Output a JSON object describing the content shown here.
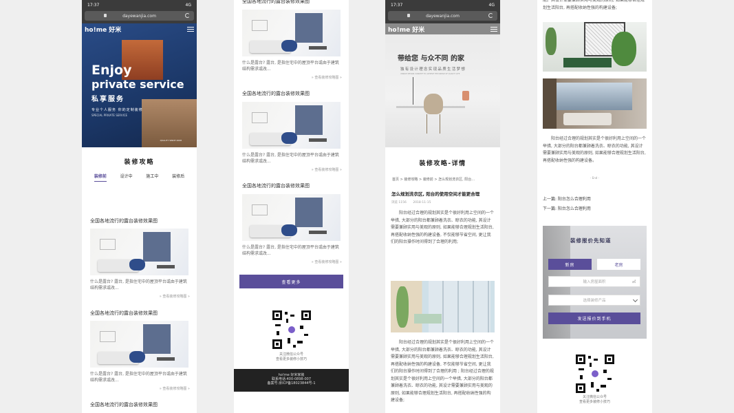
{
  "colors": {
    "accent": "#5a4e9a",
    "hero_bg": "#1f3f75",
    "phone_bar": "#3b3b3b"
  },
  "phone": {
    "time": "17:37",
    "signal": "4G",
    "url": "dayewanjia.com"
  },
  "brand": {
    "logo": "ho!me 好米"
  },
  "hero": {
    "line1": "Enjoy",
    "line2": "private service",
    "line3": "私享服务",
    "line4": "专业个人服务  你的定制装修",
    "line5": "SPECIAL PRIVATE SERVICE",
    "line6": "QUALITY SINCE 2008"
  },
  "guide": {
    "title": "装修攻略",
    "tabs": [
      "装修前",
      "设计中",
      "施工中",
      "装修后"
    ],
    "card_title": "全国各地流行的露台装修效果图",
    "card_desc": "什么是露台? 露台, 是指住宅中的屋顶平台或由于建筑结构需求或改...",
    "card_more": "» 查看装修攻略图 »"
  },
  "list2": {
    "load_more": "查看更多"
  },
  "qr": {
    "caption1": "关注微信公众号",
    "caption2": "查看更多装修小技巧"
  },
  "footer": {
    "line1": "ho!me 好米家装",
    "line2": "联系电话:400-0898-007",
    "line3": "备案号:京ICP备18023844号-1"
  },
  "banner2": {
    "big_line": "带给您 与众不同 的家",
    "sub": "独有设计理念实现品质生活梦想",
    "sub_en": "UNIQUE DESIGN CONCEPT TO ACHIEVE THE DREAM OF QUALITY LIFE"
  },
  "detail": {
    "title": "装修攻略-详情",
    "breadcrumb": "首页 > 装修攻略 > 装修前 > 怎么规划洗衣区, 阳台...",
    "article_title": "怎么规划洗衣区, 阳台的使用空间才能更合理",
    "views": "浏览 1156",
    "date": "2018-11-15",
    "para1": "阳台经过合理的规划其实是个很好利用上空间的一个举措, 大部分的阳台都兼顾着洗衣、晾衣的功能, 其设计需要兼顾实用与美观的原则, 如果能够合理规划生活阳台, 再搭配收纳性强的构建设备, 不仅能够节省空间, 更让我们的阳台操作时间得到了合理的利用;",
    "para2": "阳台经过合理的规划其实是个很好利用上空间的一个举措, 大部分的阳台都兼顾着洗衣、晾衣的功能, 其设计需要兼顾实用与美观的原则, 如果能够合理规划生活阳台, 再搭配收纳性强的构建设备, 不仅能够节省空间, 更让我们的阳台操作时间得到了合理的利用 ; 阳台经过合理的规划其实是个很好利用上空间的一个举措, 大部分的阳台都兼顾着洗衣、晾衣的功能, 其设计需要兼顾实用与美观的原则, 如果能够合理规划生活阳台, 再搭配收纳性强的构建设备;",
    "top_text": "能。其设计需要兼顾实用与美观的原则, 如果能够合理规划生活阳台, 再搭配收纳性强的构建设备;",
    "para3": "阳台经过合理的规划其实是个很好利用上空间的一个举措, 大部分的阳台都兼顾着洗衣、晾衣的功能, 其设计需要兼顾实用与美观的原则, 如果能够合理规划生活阳台, 再搭配收纳性强的构建设备。",
    "end": "- End -",
    "prev": "上一篇: 阳台怎么合理利用",
    "next": "下一篇: 阳台怎么合理利用"
  },
  "quote": {
    "title": "装修报价先知道",
    "tab_new": "新房",
    "tab_old": "老房",
    "area_placeholder": "输入房屋面积",
    "area_unit": "㎡",
    "product_placeholder": "选择装修产品",
    "submit": "发送报价到手机"
  },
  "qr2": {
    "caption1": "关注微信公众号",
    "caption2": "查看更多装修小技巧"
  }
}
